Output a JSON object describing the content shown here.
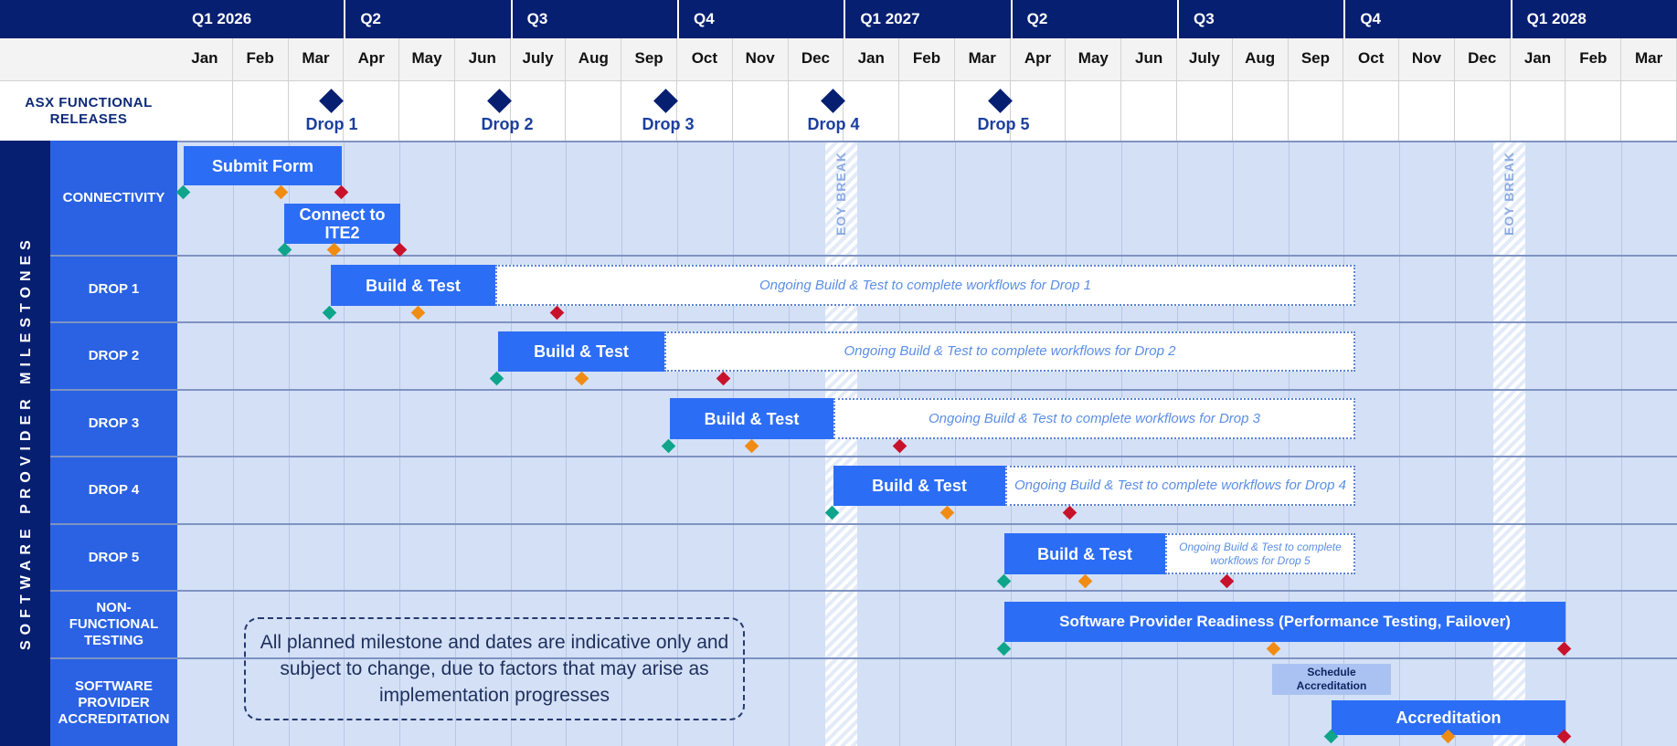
{
  "quarters": [
    "Q1 2026",
    "Q2",
    "Q3",
    "Q4",
    "Q1 2027",
    "Q2",
    "Q3",
    "Q4",
    "Q1 2028"
  ],
  "months": [
    "Jan",
    "Feb",
    "Mar",
    "Apr",
    "May",
    "Jun",
    "July",
    "Aug",
    "Sep",
    "Oct",
    "Nov",
    "Dec",
    "Jan",
    "Feb",
    "Mar",
    "Apr",
    "May",
    "Jun",
    "July",
    "Aug",
    "Sep",
    "Oct",
    "Nov",
    "Dec",
    "Jan",
    "Feb",
    "Mar"
  ],
  "release_row": {
    "label": "ASX FUNCTIONAL RELEASES",
    "drops": [
      "Drop 1",
      "Drop 2",
      "Drop 3",
      "Drop 4",
      "Drop 5"
    ]
  },
  "side_label": "SOFTWARE PROVIDER MILESTONES",
  "rows": {
    "connectivity": "CONNECTIVITY",
    "drop1": "DROP 1",
    "drop2": "DROP 2",
    "drop3": "DROP 3",
    "drop4": "DROP 4",
    "drop5": "DROP 5",
    "nft": "NON-FUNCTIONAL TESTING",
    "accreditation": "SOFTWARE PROVIDER ACCREDITATION"
  },
  "bars": {
    "submit_form": "Submit Form",
    "connect_ite2": "Connect to ITE2",
    "build_test": "Build & Test",
    "ongoing_drop1": "Ongoing Build & Test to complete workflows for Drop 1",
    "ongoing_drop2": "Ongoing Build & Test to complete workflows for Drop 2",
    "ongoing_drop3": "Ongoing Build & Test to complete workflows for Drop 3",
    "ongoing_drop4": "Ongoing Build & Test to complete workflows for Drop 4",
    "ongoing_drop5": "Ongoing Build & Test to complete workflows for Drop 5",
    "readiness": "Software Provider Readiness (Performance Testing, Failover)",
    "schedule_accreditation": "Schedule Accreditation",
    "accreditation": "Accreditation"
  },
  "eoy_break": "EOY BREAK",
  "note": "All planned milestone and dates are indicative only and subject to change, due to factors that may arise as implementation progresses",
  "colors": {
    "header_navy": "#061f71",
    "label_blue": "#2a62e3",
    "bar_blue": "#2c6df5",
    "grid_bg": "#d4e0f6",
    "milestone_start": "#0ea58a",
    "milestone_mid": "#f08c13",
    "milestone_end": "#c8122b"
  }
}
